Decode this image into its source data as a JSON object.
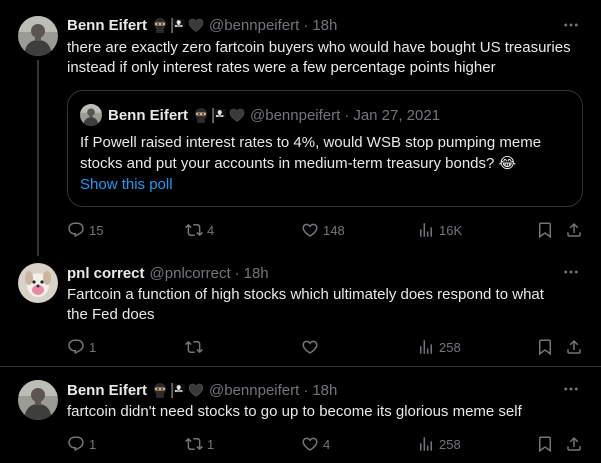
{
  "tweets": [
    {
      "name": "Benn Eifert",
      "handle": "@bennpeifert",
      "time": "18h",
      "text_lines": [
        "there are exactly zero fartcoin buyers who would have bought US treasuries",
        "instead if only interest rates were a few percentage points higher"
      ],
      "quote": {
        "name": "Benn Eifert",
        "handle": "@bennpeifert",
        "time": "Jan 27, 2021",
        "text_lines": [
          "If Powell raised interest rates to 4%, would WSB stop pumping meme",
          "stocks and put your accounts in medium-term treasury bonds? 😂"
        ],
        "link": "Show this poll"
      },
      "stats": {
        "replies": "15",
        "reposts": "4",
        "likes": "148",
        "views": "16K"
      }
    },
    {
      "name": "pnl correct",
      "handle": "@pnlcorrect",
      "time": "18h",
      "text_lines": [
        "Fartcoin a function of high stocks which ultimately does respond to what",
        "the Fed does"
      ],
      "stats": {
        "replies": "1",
        "reposts": "",
        "likes": "",
        "views": "258"
      }
    },
    {
      "name": "Benn Eifert",
      "handle": "@bennpeifert",
      "time": "18h",
      "text_lines": [
        "fartcoin didn't need stocks to go up to become its glorious meme self"
      ],
      "stats": {
        "replies": "1",
        "reposts": "1",
        "likes": "4",
        "views": "258"
      }
    }
  ],
  "separator": "·",
  "colors": {
    "background": "#000000",
    "text": "#e7e9ea",
    "muted": "#71767b",
    "link": "#1d9bf0",
    "border": "#2f3336"
  },
  "icons": [
    "ninja-emoji-icon",
    "pirate-flag-icon",
    "black-heart-icon",
    "more-icon",
    "reply-icon",
    "repost-icon",
    "like-icon",
    "views-icon",
    "bookmark-icon",
    "share-icon"
  ]
}
